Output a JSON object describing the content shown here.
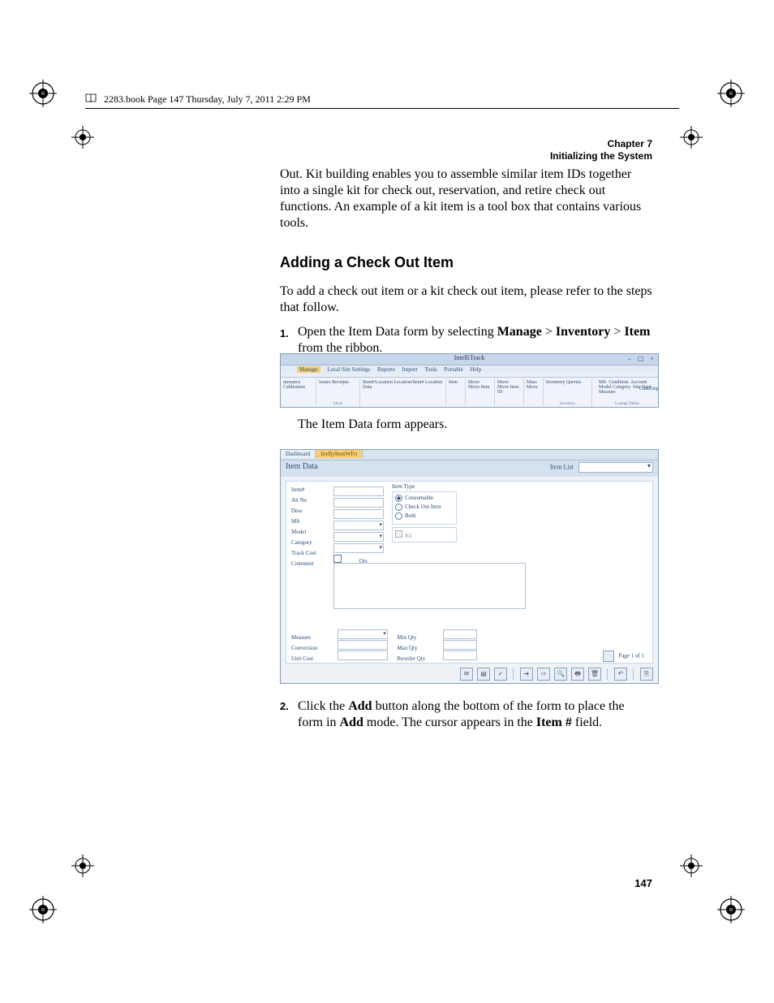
{
  "header_line": "2283.book  Page 147  Thursday, July 7, 2011  2:29 PM",
  "chapter_label": "Chapter 7",
  "chapter_title": "Initializing the System",
  "intro_para": "Out. Kit building enables you to assemble similar item IDs together into a single kit for check out, reservation, and retire check out functions. An example of a kit item is a tool box that contains various tools.",
  "section_heading": "Adding a Check Out Item",
  "section_intro": "To add a check out item or a kit check out item, please refer to the steps that follow.",
  "steps": {
    "s1_num": "1.",
    "s1_a": "Open the Item Data form by selecting ",
    "s1_b1": "Manage",
    "s1_gt1": " > ",
    "s1_b2": "Inventory",
    "s1_gt2": " > ",
    "s1_b3": "Item",
    "s1_c": " from the ribbon.",
    "s1_caption": "The Item Data form appears.",
    "s2_num": "2.",
    "s2_a": "Click the ",
    "s2_b1": "Add",
    "s2_b": " button along the bottom of the form to place the form in ",
    "s2_b2": "Add",
    "s2_c": " mode. The cursor appears in the ",
    "s2_b3": "Item #",
    "s2_d": " field."
  },
  "ribbon": {
    "app_title": "IntelliTrack",
    "window_buttons": "–  ▢  ×",
    "menus": [
      "Manage",
      "Local Site Settings",
      "Reports",
      "Import",
      "Tools",
      "Portable",
      "Help"
    ],
    "groups_left": [
      "ntenance Calibration",
      "Issues  Receipts",
      "Item#/Location  Location/Item#  Location Data",
      "Item",
      "Move Move Item",
      "Move Move Item ID",
      "Mass Move",
      "Inventory  Queries"
    ],
    "groups_right_top": [
      "Mfr",
      "Condition",
      "Account"
    ],
    "groups_right_bot": [
      "Model Category",
      "Site Dept",
      "Measure"
    ],
    "group_label_stock": "Stock",
    "group_label_inventory": "Inventory",
    "group_label_lookup": "Lookup Tables",
    "cust": "Cust/Emp"
  },
  "form": {
    "tab1": "Dashboard",
    "tab2": "InvByItemWFrt",
    "title": "Item Data",
    "itemlist": "Item List",
    "labels_left": [
      "Item#",
      "Alt No",
      "Desc",
      "Mfr",
      "Model",
      "Category",
      "Track Cost",
      "Comment"
    ],
    "qty": "Qty",
    "itemtype_title": "Item Type",
    "radio1": "Consumable",
    "radio2": "Check Out Item",
    "radio3": "Both",
    "kit": "Kit",
    "lower_left": [
      "Measure",
      "Conversion",
      "Unit Cost"
    ],
    "lower_right": [
      "Min Qty",
      "Max Qty",
      "Reorder Qty"
    ],
    "page_of": "Page 1 of 1",
    "toolbar_icons": [
      "✉",
      "▤",
      "✓",
      "➔",
      "⇨",
      "🔍",
      "🖶",
      "🗑",
      "↶",
      "⎘"
    ]
  },
  "page_number": "147"
}
